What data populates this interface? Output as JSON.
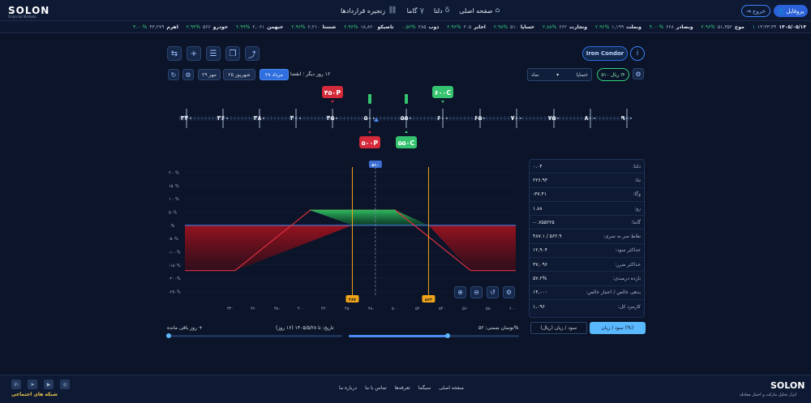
{
  "header": {
    "logo": "SOLON",
    "logo_sub": "Financial Markets",
    "nav": [
      {
        "label": "صفحه اصلی",
        "icon": "home-icon",
        "glyph": "⌂"
      },
      {
        "label": "دلتا",
        "icon": "delta-icon",
        "glyph": "δ"
      },
      {
        "label": "گاما",
        "icon": "gamma-icon",
        "glyph": "γ"
      },
      {
        "label": "زنجیره قراردادها",
        "icon": "link-icon",
        "glyph": "⛓"
      }
    ],
    "exit_label": "خروج",
    "profile_label": "پروفایل"
  },
  "ticker": [
    {
      "date": "۱۴۰۵/۰۵/۱۴",
      "price": "۱۳:۳۳:۳۴",
      "chg": "۱"
    },
    {
      "name": "موج",
      "price": "۵۱,۳۵۲",
      "chg": "۲.۹۶%"
    },
    {
      "name": "وبصادر",
      "price": "۶۶۸",
      "chg": "۴.۰۰%"
    },
    {
      "name": "وبملت",
      "price": "۱,۱۹۹",
      "chg": "۲.۹۶%"
    },
    {
      "name": "ونجارت",
      "price": "۶۶۲",
      "chg": "۲.۸۸%"
    },
    {
      "name": "خساپا",
      "price": "۵۱۰",
      "chg": "۲.۹۸%"
    },
    {
      "name": "اخابر",
      "price": "۲۰۵",
      "chg": "۲.۹۶%"
    },
    {
      "name": "ذوب",
      "price": "۲۸۵",
      "chg": "۰.۵۲%"
    },
    {
      "name": "تاصیکو",
      "price": "۱۸,۸۲۰",
      "chg": "۲.۹۶%"
    },
    {
      "name": "شستا",
      "price": "۲,۲۱۰",
      "chg": "۲.۹۶%"
    },
    {
      "name": "خبهمن",
      "price": "۲,۰۶۱",
      "chg": "۲.۹۹%"
    },
    {
      "name": "خودرو",
      "price": "۵۶۶",
      "chg": "۲.۹۴%"
    },
    {
      "name": "اهرم",
      "price": "۴۳,۲۷۹",
      "chg": "۴.۰۰%"
    }
  ],
  "toolbar": {
    "buttons": [
      {
        "name": "swap-icon",
        "glyph": "⇆"
      },
      {
        "name": "plus-icon",
        "glyph": "+"
      },
      {
        "name": "checklist-icon",
        "glyph": "☰"
      },
      {
        "name": "bookmark-icon",
        "glyph": "❐"
      },
      {
        "name": "share-icon",
        "glyph": "⤴"
      }
    ],
    "strategy": "Iron Condor",
    "info_glyph": "i"
  },
  "controls": {
    "refresh_glyph": "↻",
    "gear_glyph": "⚙",
    "dates": [
      {
        "label": "۲۹ مهر",
        "active": false
      },
      {
        "label": "۲۵ شهریور",
        "active": false
      },
      {
        "label": "۲۸ مرداد",
        "active": true
      }
    ],
    "expiry_text": "۱۶ روز دیگر ؛ انقضا",
    "select_value": "خساپا",
    "select_label": "نماد",
    "rial_label": "۵۱۰ ریال"
  },
  "ruler": {
    "ticks": [
      "۳۴۰",
      "۳۶۰",
      "۳۸۰",
      "۴۰۰",
      "۴۵۰",
      "۵۰۰",
      "۵۵۰",
      "۶۰۰",
      "۶۵۰",
      "۷۰۰",
      "۷۵۰",
      "۸۰۰",
      "۹۰۰"
    ],
    "legs": [
      {
        "label": "۴۵۰P",
        "strike": 450,
        "side": "top",
        "color": "#d42a3a"
      },
      {
        "label": "۶۰۰C",
        "strike": 600,
        "side": "top",
        "color": "#35c36f"
      },
      {
        "label": "۵۰۰P",
        "strike": 500,
        "side": "bottom",
        "color": "#d42a3a"
      },
      {
        "label": "۵۵۰C",
        "strike": 550,
        "side": "bottom",
        "color": "#35c36f"
      }
    ],
    "spot": 510
  },
  "chart_data": {
    "type": "line",
    "x_ticks": [
      340,
      360,
      380,
      400,
      420,
      450,
      480,
      500,
      520,
      540,
      560,
      580,
      600
    ],
    "x_tick_labels": [
      "۳۴۰",
      "۳۶۰",
      "۳۸۰",
      "۴۰۰",
      "۴۲۰",
      "۴۵۰",
      "۴۸۰",
      "۵۰۰",
      "۵۲۰",
      "۵۴۰",
      "۵۶۰",
      "۵۸۰",
      "۶۰۰"
    ],
    "y_ticks": [
      200,
      150,
      100,
      50,
      0,
      -50,
      -100,
      -150,
      -200,
      -250
    ],
    "y_tick_labels": [
      "۲۰۰%",
      "۱۵۰%",
      "۱۰۰%",
      "۵۰%",
      "۰%",
      "-۵۰%",
      "-۱۰۰%",
      "-۱۵۰%",
      "-۲۰۰%",
      "-۲۵۰%"
    ],
    "x": [
      320,
      370,
      445,
      490,
      530,
      605,
      650
    ],
    "y": [
      -171,
      -171,
      57,
      57,
      57,
      -171,
      -171
    ],
    "breakevens": [
      {
        "x": 487,
        "label": "۴۸۷"
      },
      {
        "x": 563,
        "label": "۵۶۳"
      }
    ],
    "spot": {
      "x": 510,
      "label": "۵۱۰"
    },
    "xlim": [
      320,
      650
    ],
    "ylim": [
      -270,
      220
    ]
  },
  "chart_tools": [
    {
      "name": "zoom-in-icon",
      "glyph": "⊕"
    },
    {
      "name": "zoom-out-icon",
      "glyph": "⊖"
    },
    {
      "name": "reset-icon",
      "glyph": "↺"
    },
    {
      "name": "settings-icon",
      "glyph": "⚙"
    }
  ],
  "stats": [
    {
      "label": "دلتا:",
      "value": "۰.۰۴"
    },
    {
      "label": "تتا:",
      "value": "۲۲۶.۹۳"
    },
    {
      "label": "وگا:",
      "value": "-۳۷.۴۱"
    },
    {
      "label": "رو:",
      "value": "۱.۸۸"
    },
    {
      "label": "گاما:",
      "value": "-۰.۷۵۵۲۲۵"
    },
    {
      "label": "نقاط سر به سری:",
      "value": "۴۸۷.۱ / ۵۶۲.۹"
    },
    {
      "label": "حداکثر سود:",
      "value": "۱۲,۹۰۴"
    },
    {
      "label": "حداکثر ضرر:",
      "value": "۳۷,۰۹۶"
    },
    {
      "label": "بازده درصدی:",
      "value": "۵۷.۲%"
    },
    {
      "label": "بدهی خالص / اعتبار خالص:",
      "value": "۱۴,۰۰۰"
    },
    {
      "label": "کارمزد کل:",
      "value": "۱,۰۹۶"
    }
  ],
  "bottom": {
    "toggle_rial": "سود / زیان (ریال)",
    "toggle_pct": "سود / زیان (%)",
    "volatility_label": "نوسان ضمنی: ۵۲%",
    "volatility": 0.58,
    "date_label": "تاریخ: تا ۱۴۰۵/۵/۲۸ (۱۶ روز)",
    "days_label": "+ روز باقی مانده"
  },
  "footer": {
    "social_label": "شبکه های اجتماعی",
    "social": [
      {
        "name": "linkedin-icon",
        "glyph": "in"
      },
      {
        "name": "telegram-icon",
        "glyph": "➤"
      },
      {
        "name": "youtube-icon",
        "glyph": "▶"
      },
      {
        "name": "instagram-icon",
        "glyph": "◎"
      }
    ],
    "links": [
      "صفحه اصلی",
      "سیگما",
      "تعرفه‌ها",
      "تماس با ما",
      "درباره ما"
    ],
    "logo": "SOLON",
    "tagline": "ابزار تحلیل مارکت و اختیار معامله"
  }
}
